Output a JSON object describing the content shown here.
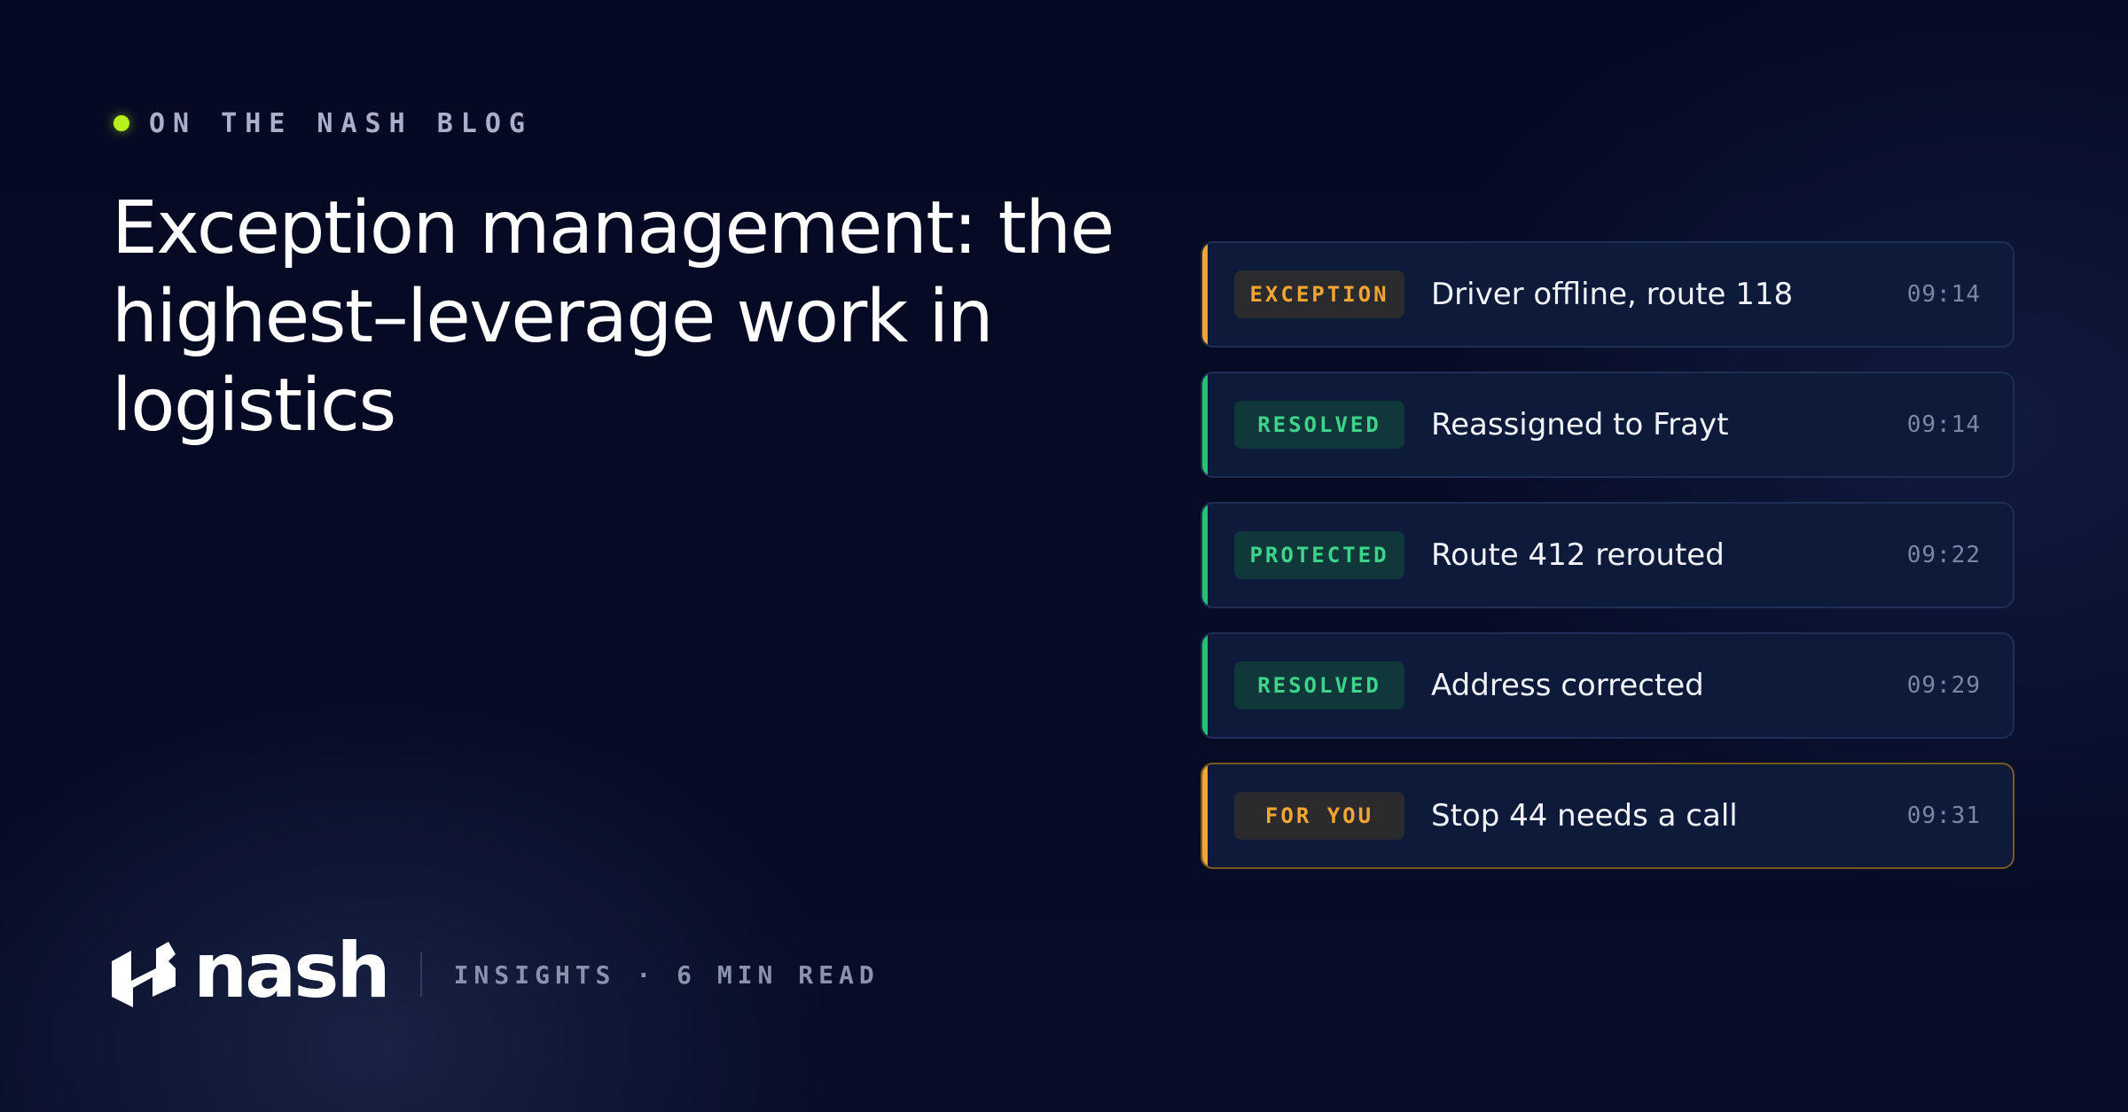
{
  "eyebrow": {
    "label": "ON THE NASH BLOG"
  },
  "headline": {
    "text": "Exception management: the highest–leverage work in logistics"
  },
  "feed": {
    "items": [
      {
        "badge": "EXCEPTION",
        "badge_tone": "warn",
        "title": "Driver offline, route 118",
        "time": "09:14",
        "accent_color": "#f2a533"
      },
      {
        "badge": "RESOLVED",
        "badge_tone": "ok",
        "title": "Reassigned to Frayt",
        "time": "09:14",
        "accent_color": "#27c46f"
      },
      {
        "badge": "PROTECTED",
        "badge_tone": "ok",
        "title": "Route 412 rerouted",
        "time": "09:22",
        "accent_color": "#27c46f"
      },
      {
        "badge": "RESOLVED",
        "badge_tone": "ok",
        "title": "Address corrected",
        "time": "09:29",
        "accent_color": "#27c46f"
      },
      {
        "badge": "FOR YOU",
        "badge_tone": "warn",
        "title": "Stop 44 needs a call",
        "time": "09:31",
        "accent_color": "#f2a533",
        "highlighted": true
      }
    ]
  },
  "footer": {
    "brand": "nash",
    "logo_icon": "nash-logo-mark-icon",
    "meta": "INSIGHTS · 6 MIN READ"
  },
  "colors": {
    "background": "#060b24",
    "eyebrow_dot": "#b8f01e",
    "warn": "#f2a533",
    "ok": "#27c46f"
  }
}
